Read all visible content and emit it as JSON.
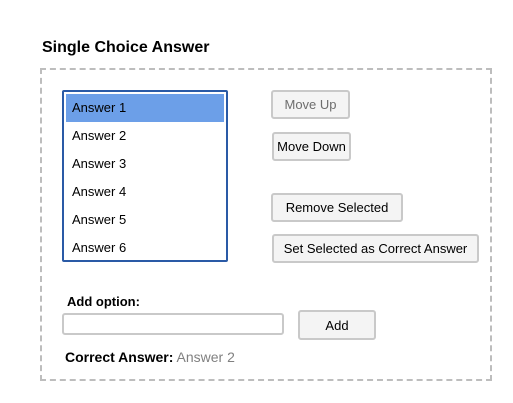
{
  "title": "Single Choice Answer",
  "options": [
    "Answer 1",
    "Answer 2",
    "Answer 3",
    "Answer 4",
    "Answer 5",
    "Answer 6"
  ],
  "selected_option": "Answer 1",
  "buttons": {
    "move_up": "Move Up",
    "move_down": "Move Down",
    "remove_selected": "Remove Selected",
    "set_correct": "Set Selected as Correct Answer",
    "add": "Add"
  },
  "add_option": {
    "label": "Add option:",
    "value": "",
    "placeholder": ""
  },
  "correct_answer": {
    "label": "Correct Answer:",
    "value": "Answer 2"
  },
  "colors": {
    "selection": "#6c9fe8",
    "listbox_border": "#2a5aa6",
    "panel_border": "#bdbdbd"
  }
}
